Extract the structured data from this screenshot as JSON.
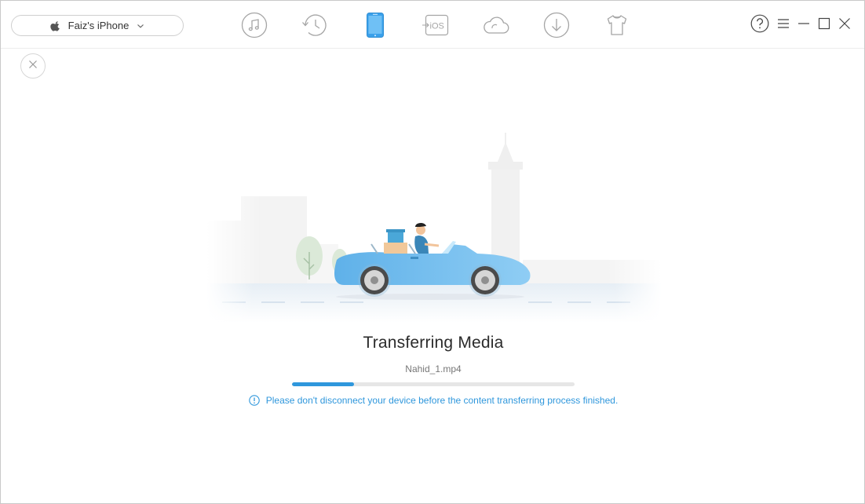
{
  "device": {
    "name": "Faiz's iPhone",
    "icon": "apple-icon",
    "dropdown_icon": "chevron-down-icon"
  },
  "nav": {
    "items": [
      {
        "name": "music-icon",
        "active": false
      },
      {
        "name": "history-icon",
        "active": false
      },
      {
        "name": "phone-icon",
        "active": true
      },
      {
        "name": "ios-mover-icon",
        "label": "iOS",
        "active": false
      },
      {
        "name": "cloud-icon",
        "active": false
      },
      {
        "name": "download-icon",
        "active": false
      },
      {
        "name": "tshirt-icon",
        "active": false
      }
    ],
    "active_color": "#3aa0ea",
    "inactive_color": "#a5a5a5"
  },
  "window_controls": [
    "help-icon",
    "menu-icon",
    "minimize-icon",
    "maximize-icon",
    "close-icon"
  ],
  "transfer": {
    "title": "Transferring Media",
    "filename": "Nahid_1.mp4",
    "progress_percent": 22,
    "warning": "Please don't disconnect your device before the content transferring process finished."
  },
  "colors": {
    "accent": "#2f97dc",
    "car": "#6cb9ec"
  }
}
